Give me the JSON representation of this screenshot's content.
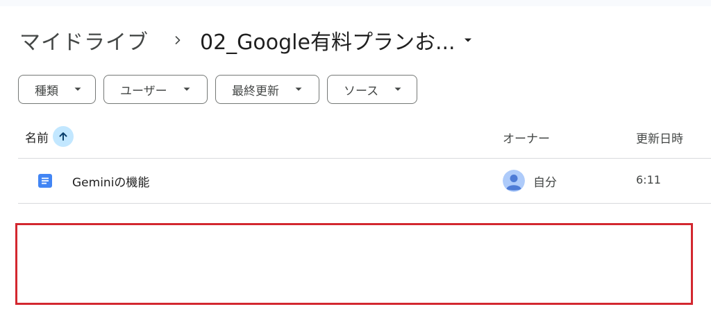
{
  "breadcrumb": {
    "root_label": "マイドライブ",
    "current_label": "02_Google有料プランお...",
    "separator_icon": "chevron-right-icon",
    "caret_icon": "caret-down-icon"
  },
  "filters": [
    {
      "label": "種類",
      "icon": "caret-down-icon"
    },
    {
      "label": "ユーザー",
      "icon": "caret-down-icon"
    },
    {
      "label": "最終更新",
      "icon": "caret-down-icon"
    },
    {
      "label": "ソース",
      "icon": "caret-down-icon"
    }
  ],
  "table": {
    "columns": {
      "name": "名前",
      "owner": "オーナー",
      "modified": "更新日時"
    },
    "sort_icon": "arrow-up-icon",
    "rows": [
      {
        "icon": "google-docs-icon",
        "name": "Geminiの機能",
        "owner": "自分",
        "modified": "6:11"
      }
    ]
  },
  "colors": {
    "accent": "#c2e7ff",
    "docs_blue": "#4285f4",
    "highlight_red": "#d3272f",
    "avatar_bg": "#aecbfa",
    "avatar_fg": "#4d7bd6"
  }
}
